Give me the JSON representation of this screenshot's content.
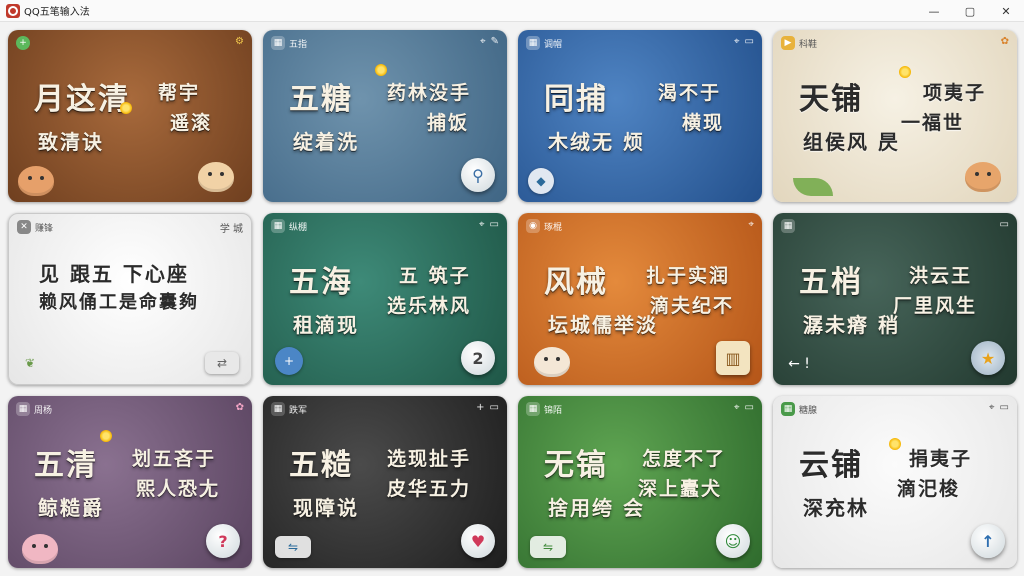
{
  "window": {
    "title": "QQ五笔输入法"
  },
  "cards": [
    {
      "tag": "",
      "big": "月",
      "big2": "这清",
      "side1": "帮宇",
      "side2": "遥滚",
      "line2": "致清诀"
    },
    {
      "tag": "五指",
      "big": "五",
      "big2": "糖",
      "side1": "药林没手",
      "side2": "捕饭",
      "line2": "绽着洗"
    },
    {
      "tag": "调帽",
      "big": "同",
      "big2": "捕",
      "side1": "渴不于",
      "side2": "横现",
      "line2": "木绒无 烦"
    },
    {
      "tag": "科鞋",
      "big": "天",
      "big2": "铺",
      "side1": "项夷子",
      "side2": "一福世",
      "line2": "组侯风 昃"
    },
    {
      "tag": "赚锋",
      "big": "见",
      "big2": "跟五 下心座",
      "side1": "学 城",
      "side2": "",
      "line2": "赖风俑工是命囊夠"
    },
    {
      "tag": "纵棚",
      "big": "五",
      "big2": "海",
      "side1": "五 筑子",
      "side2": "选乐林风",
      "line2": "租滴现"
    },
    {
      "tag": "琢棍",
      "big": "风",
      "big2": "械",
      "side1": "扎于实润",
      "side2": "滴夫纪不",
      "line2": "坛城儒举淡"
    },
    {
      "tag": "",
      "big": "五",
      "big2": "梢",
      "side1": "洪云王",
      "side2": "厂里风生",
      "line2": "潺未瘠 稍"
    },
    {
      "tag": "周杨",
      "big": "五",
      "big2": "清",
      "side1": "划五吝于",
      "side2": "熙人恐尢",
      "line2": "鲸糙爵"
    },
    {
      "tag": "跌军",
      "big": "五",
      "big2": "糙",
      "side1": "选现扯手",
      "side2": "皮华五力",
      "line2": "现障说"
    },
    {
      "tag": "锦陌",
      "big": "无",
      "big2": "镐",
      "side1": "怎度不了",
      "side2": "深上蠹犬",
      "line2": "捨用绔 会"
    },
    {
      "tag": "糖腺",
      "big": "云",
      "big2": "铺",
      "side1": "捐夷子",
      "side2": "滴汜梭",
      "line2": "深充林"
    }
  ]
}
